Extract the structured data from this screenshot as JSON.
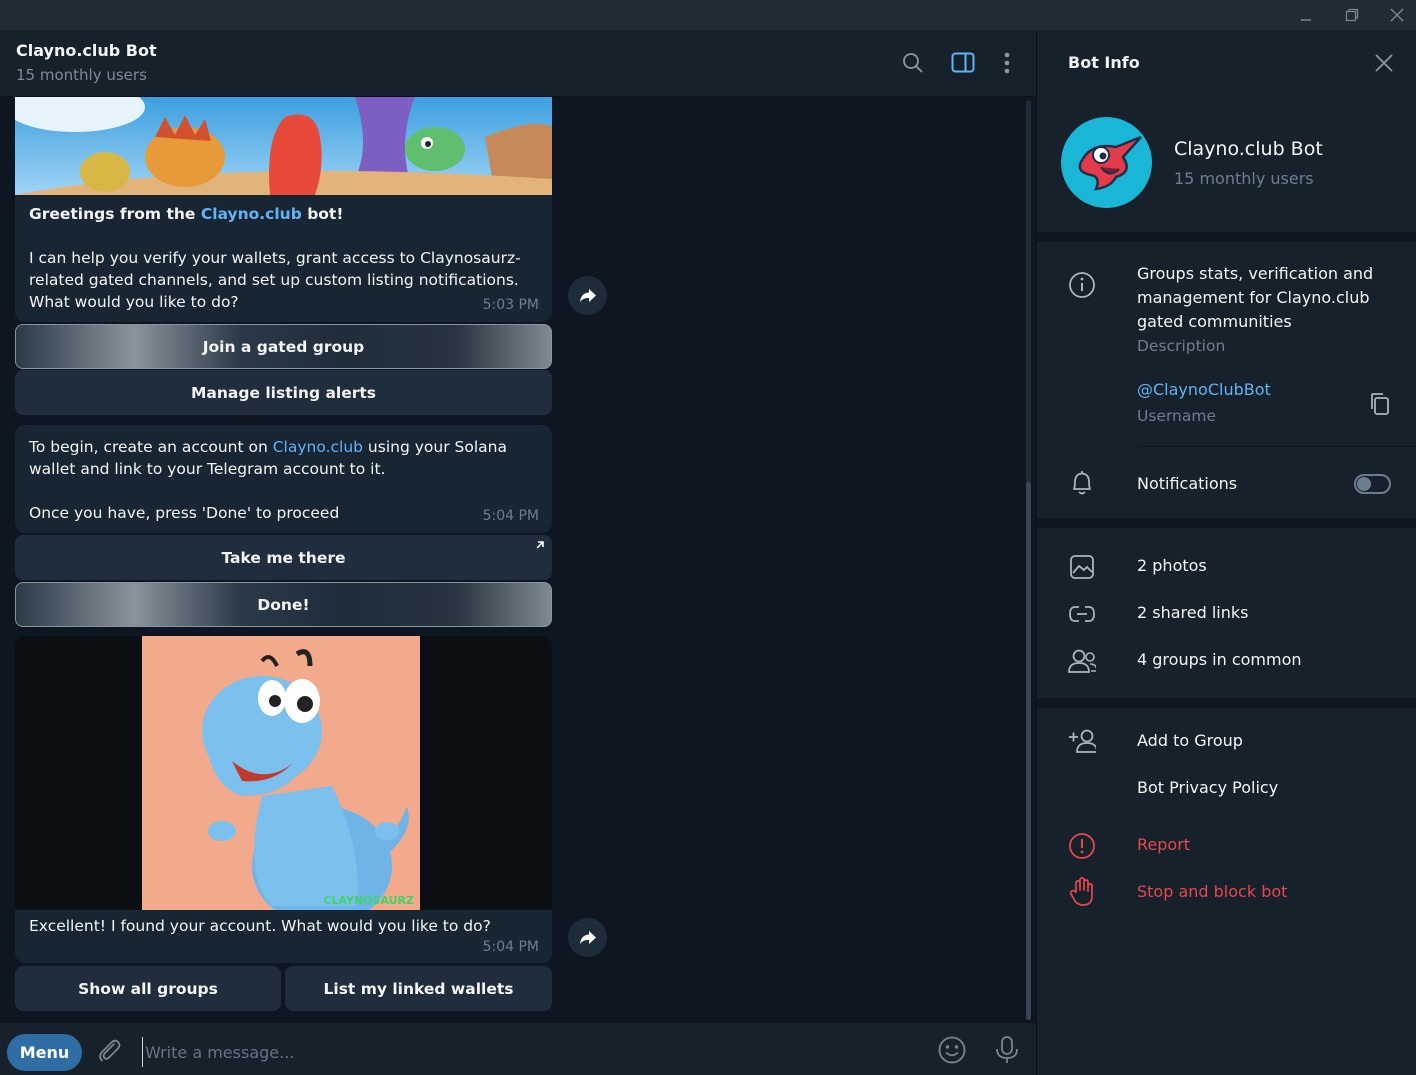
{
  "window": {
    "minimize_icon": "minimize-icon",
    "restore_icon": "restore-icon",
    "close_icon": "close-icon"
  },
  "header": {
    "title": "Clayno.club Bot",
    "subtitle": "15 monthly users"
  },
  "messages": {
    "m1": {
      "greeting_pre": "Greetings from the ",
      "greeting_link": "Clayno.club",
      "greeting_post": " bot!",
      "body": "I can help you verify your wallets, grant access to Claynosaurz-related gated channels, and set up custom listing notifications. What would you like to do?",
      "time": "5:03 PM",
      "buttons": [
        "Join a gated group",
        "Manage listing alerts"
      ]
    },
    "m2": {
      "pre": "To begin, create an account on ",
      "link": "Clayno.club",
      "post": " using your Solana wallet and link to your Telegram account to it.",
      "body2": "Once you have, press 'Done' to proceed",
      "time": "5:04 PM",
      "buttons": [
        "Take me there",
        "Done!"
      ]
    },
    "m3": {
      "image_watermark": "CLAYNOSAURZ",
      "text": "Excellent! I found your account. What would you like to do?",
      "time": "5:04 PM",
      "buttons": [
        "Show all groups",
        "List my linked wallets"
      ]
    }
  },
  "composer": {
    "menu_label": "Menu",
    "placeholder": "Write a message..."
  },
  "panel": {
    "title": "Bot Info",
    "name": "Clayno.club Bot",
    "subtitle": "15 monthly users",
    "description": "Groups stats, verification and management for Clayno.club gated communities",
    "description_label": "Description",
    "username": "@ClaynoClubBot",
    "username_label": "Username",
    "notifications_label": "Notifications",
    "notifications_on": false,
    "photos": "2 photos",
    "links": "2 shared links",
    "groups": "4 groups in common",
    "add_to_group": "Add to Group",
    "privacy": "Bot Privacy Policy",
    "report": "Report",
    "block": "Stop and block bot"
  },
  "colors": {
    "accent": "#5eb5f7",
    "danger": "#e5484d",
    "menu_button": "#2f6ea5",
    "background": "#0e1621",
    "panel": "#17212b"
  }
}
